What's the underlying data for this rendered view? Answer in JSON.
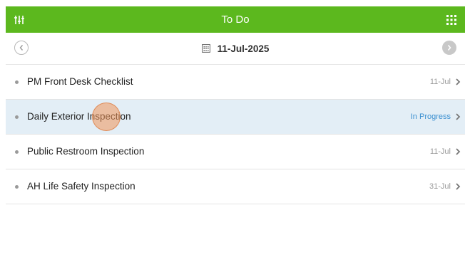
{
  "header": {
    "title": "To Do",
    "left_icon": "filter-sliders-icon",
    "right_icon": "grid-menu-icon"
  },
  "date_nav": {
    "date": "11-Jul-2025",
    "prev_icon": "chevron-left-icon",
    "next_icon": "chevron-right-icon",
    "calendar_icon": "calendar-icon"
  },
  "tasks": [
    {
      "label": "PM Front Desk Checklist",
      "meta": "11-Jul"
    },
    {
      "label": "Daily Exterior Inspection",
      "meta": "In Progress",
      "selected": true
    },
    {
      "label": "Public Restroom Inspection",
      "meta": "11-Jul"
    },
    {
      "label": "AH Life Safety Inspection",
      "meta": "31-Jul"
    }
  ],
  "colors": {
    "header_bg": "#5cb81e",
    "selected_row_bg": "#e3eef6",
    "in_progress_text": "#3a8fd0"
  }
}
